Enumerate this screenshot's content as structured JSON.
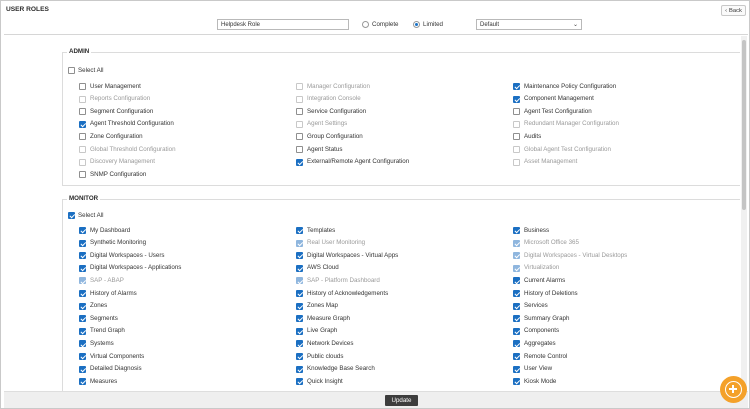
{
  "page": {
    "title": "USER ROLES",
    "back_label": "Back"
  },
  "toolbar": {
    "role_name": "Helpdesk Role",
    "radio_options": [
      {
        "label": "Complete",
        "selected": false
      },
      {
        "label": "Limited",
        "selected": true
      }
    ],
    "scope_value": "Default"
  },
  "admin": {
    "title": "ADMIN",
    "select_all_label": "Select All",
    "select_all_checked": false,
    "columns": [
      [
        {
          "label": "User Management",
          "checked": false,
          "disabled": false
        },
        {
          "label": "Reports Configuration",
          "checked": false,
          "disabled": true
        },
        {
          "label": "Segment Configuration",
          "checked": false,
          "disabled": false
        },
        {
          "label": "Agent Threshold Configuration",
          "checked": true,
          "disabled": false
        },
        {
          "label": "Zone Configuration",
          "checked": false,
          "disabled": false
        },
        {
          "label": "Global Threshold Configuration",
          "checked": false,
          "disabled": true
        },
        {
          "label": "Discovery Management",
          "checked": false,
          "disabled": true
        },
        {
          "label": "SNMP Configuration",
          "checked": false,
          "disabled": false
        }
      ],
      [
        {
          "label": "Manager Configuration",
          "checked": false,
          "disabled": true
        },
        {
          "label": "Integration Console",
          "checked": false,
          "disabled": true
        },
        {
          "label": "Service Configuration",
          "checked": false,
          "disabled": false
        },
        {
          "label": "Agent Settings",
          "checked": false,
          "disabled": true
        },
        {
          "label": "Group Configuration",
          "checked": false,
          "disabled": false
        },
        {
          "label": "Agent Status",
          "checked": false,
          "disabled": false
        },
        {
          "label": "External/Remote Agent Configuration",
          "checked": true,
          "disabled": false
        }
      ],
      [
        {
          "label": "Maintenance Policy Configuration",
          "checked": true,
          "disabled": false
        },
        {
          "label": "Component Management",
          "checked": true,
          "disabled": false
        },
        {
          "label": "Agent Test Configuration",
          "checked": false,
          "disabled": false
        },
        {
          "label": "Redundant Manager Configuration",
          "checked": false,
          "disabled": true
        },
        {
          "label": "Audits",
          "checked": false,
          "disabled": false
        },
        {
          "label": "Global Agent Test Configuration",
          "checked": false,
          "disabled": true
        },
        {
          "label": "Asset Management",
          "checked": false,
          "disabled": true
        }
      ]
    ]
  },
  "monitor": {
    "title": "MONITOR",
    "select_all_label": "Select All",
    "select_all_checked": true,
    "columns": [
      [
        {
          "label": "My Dashboard",
          "checked": true,
          "disabled": false
        },
        {
          "label": "Synthetic Monitoring",
          "checked": true,
          "disabled": false
        },
        {
          "label": "Digital Workspaces - Users",
          "checked": true,
          "disabled": false
        },
        {
          "label": "Digital Workspaces - Applications",
          "checked": true,
          "disabled": false
        },
        {
          "label": "SAP - ABAP",
          "checked": true,
          "disabled": true
        },
        {
          "label": "History of Alarms",
          "checked": true,
          "disabled": false
        },
        {
          "label": "Zones",
          "checked": true,
          "disabled": false
        },
        {
          "label": "Segments",
          "checked": true,
          "disabled": false
        },
        {
          "label": "Trend Graph",
          "checked": true,
          "disabled": false
        },
        {
          "label": "Systems",
          "checked": true,
          "disabled": false
        },
        {
          "label": "Virtual Components",
          "checked": true,
          "disabled": false
        },
        {
          "label": "Detailed Diagnosis",
          "checked": true,
          "disabled": false
        },
        {
          "label": "Measures",
          "checked": true,
          "disabled": false
        }
      ],
      [
        {
          "label": "Templates",
          "checked": true,
          "disabled": false
        },
        {
          "label": "Real User Monitoring",
          "checked": true,
          "disabled": true
        },
        {
          "label": "Digital Workspaces - Virtual Apps",
          "checked": true,
          "disabled": false
        },
        {
          "label": "AWS Cloud",
          "checked": true,
          "disabled": false
        },
        {
          "label": "SAP - Platform Dashboard",
          "checked": true,
          "disabled": true
        },
        {
          "label": "History of Acknowledgements",
          "checked": true,
          "disabled": false
        },
        {
          "label": "Zones Map",
          "checked": true,
          "disabled": false
        },
        {
          "label": "Measure Graph",
          "checked": true,
          "disabled": false
        },
        {
          "label": "Live Graph",
          "checked": true,
          "disabled": false
        },
        {
          "label": "Network Devices",
          "checked": true,
          "disabled": false
        },
        {
          "label": "Public clouds",
          "checked": true,
          "disabled": false
        },
        {
          "label": "Knowledge Base Search",
          "checked": true,
          "disabled": false
        },
        {
          "label": "Quick Insight",
          "checked": true,
          "disabled": false
        }
      ],
      [
        {
          "label": "Business",
          "checked": true,
          "disabled": false
        },
        {
          "label": "Microsoft Office 365",
          "checked": true,
          "disabled": true
        },
        {
          "label": "Digital Workspaces - Virtual Desktops",
          "checked": true,
          "disabled": true
        },
        {
          "label": "Virtualization",
          "checked": true,
          "disabled": true
        },
        {
          "label": "Current Alarms",
          "checked": true,
          "disabled": false
        },
        {
          "label": "History of Deletions",
          "checked": true,
          "disabled": false
        },
        {
          "label": "Services",
          "checked": true,
          "disabled": false
        },
        {
          "label": "Summary Graph",
          "checked": true,
          "disabled": false
        },
        {
          "label": "Components",
          "checked": true,
          "disabled": false
        },
        {
          "label": "Aggregates",
          "checked": true,
          "disabled": false
        },
        {
          "label": "Remote Control",
          "checked": true,
          "disabled": false
        },
        {
          "label": "User View",
          "checked": true,
          "disabled": false
        },
        {
          "label": "Kiosk Mode",
          "checked": true,
          "disabled": false
        }
      ]
    ]
  },
  "footer": {
    "update_label": "Update"
  },
  "icons": {
    "back": "chevron-left-icon",
    "fab": "plus-circle-icon",
    "select": "chevron-down-icon"
  },
  "colors": {
    "accent": "#1b6fc2",
    "fab": "#f4a12a",
    "update_button": "#3d3d3d"
  }
}
